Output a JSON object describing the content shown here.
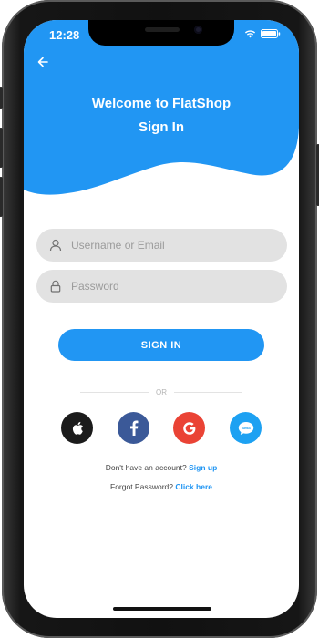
{
  "status_bar": {
    "time": "12:28"
  },
  "header": {
    "line1": "Welcome to FlatShop",
    "line2": "Sign In",
    "background_color": "#2196f3"
  },
  "form": {
    "username": {
      "placeholder": "Username or Email",
      "value": "",
      "icon": "user-icon"
    },
    "password": {
      "placeholder": "Password",
      "value": "",
      "icon": "lock-icon"
    },
    "submit_label": "SIGN IN"
  },
  "divider": {
    "label": "OR"
  },
  "social": [
    {
      "name": "apple",
      "icon": "apple-icon",
      "color": "#1b1b1b"
    },
    {
      "name": "facebook",
      "icon": "facebook-icon",
      "color": "#3b5998"
    },
    {
      "name": "google",
      "icon": "google-icon",
      "color": "#ea4335"
    },
    {
      "name": "sms",
      "icon": "sms-icon",
      "label": "SMS",
      "color": "#1da1f2"
    }
  ],
  "footer": {
    "signup_prompt": "Don't have an account?",
    "signup_link": "Sign up",
    "forgot_prompt": "Forgot Password?",
    "forgot_link": "Click here"
  }
}
